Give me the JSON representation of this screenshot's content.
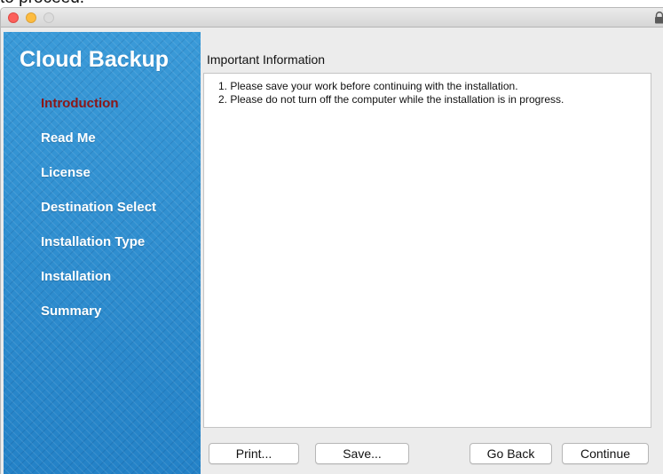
{
  "behind_text": "to proceed.",
  "app": {
    "title": "Cloud Backup"
  },
  "steps": [
    {
      "label": "Introduction",
      "active": true
    },
    {
      "label": "Read Me",
      "active": false
    },
    {
      "label": "License",
      "active": false
    },
    {
      "label": "Destination Select",
      "active": false
    },
    {
      "label": "Installation Type",
      "active": false
    },
    {
      "label": "Installation",
      "active": false
    },
    {
      "label": "Summary",
      "active": false
    }
  ],
  "content": {
    "section_title": "Important Information",
    "items": [
      "1. Please save your work before continuing with the installation.",
      "2. Please do not turn off the computer while the installation is in progress."
    ]
  },
  "buttons": {
    "print": "Print...",
    "save": "Save...",
    "go_back": "Go Back",
    "continue": "Continue"
  },
  "colors": {
    "sidebar": "#2c8fd0",
    "active_step": "#8b1616",
    "close": "#fc605b",
    "minimize": "#fdbc40"
  },
  "icons": {
    "titlebar_right": "lock-icon"
  }
}
